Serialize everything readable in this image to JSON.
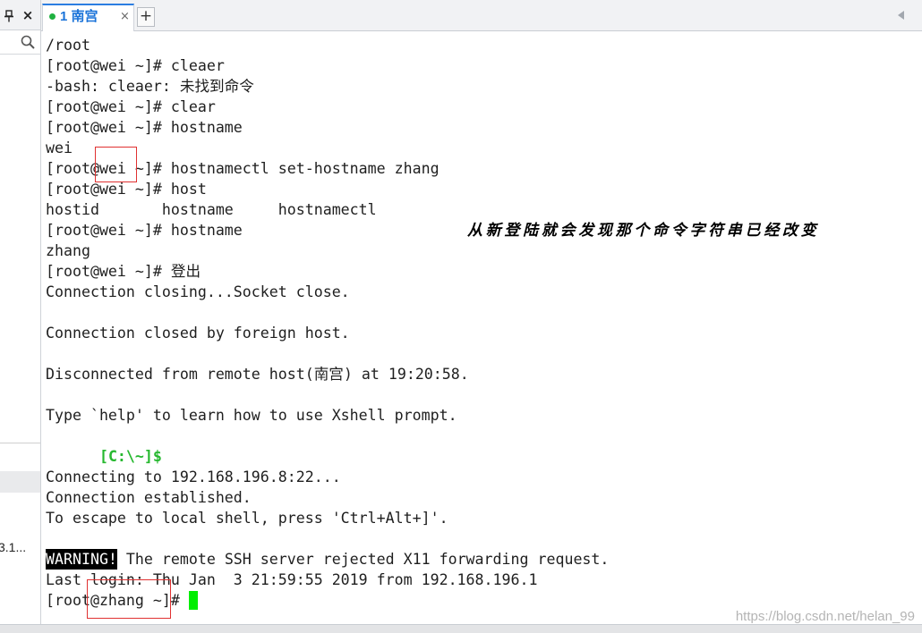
{
  "sidebar": {
    "close_label": "×",
    "partial_item": "3.1..."
  },
  "tabbar": {
    "tabs": [
      {
        "label": "1 南宫",
        "close_label": "×"
      }
    ],
    "new_tab_label": "+"
  },
  "icons": {
    "pin": "pin-icon",
    "search": "search-icon",
    "tab_status": "green-dot-icon",
    "scroll_tabs_left": "triangle-left-icon"
  },
  "terminal": {
    "lines": [
      "/root",
      "[root@wei ~]# cleaer",
      "-bash: cleaer: 未找到命令",
      "[root@wei ~]# clear",
      "[root@wei ~]# hostname",
      "wei",
      "[root@wei ~]# hostnamectl set-hostname zhang",
      "[root@wei ~]# host",
      "hostid       hostname     hostnamectl",
      "[root@wei ~]# hostname",
      "zhang",
      "[root@wei ~]# 登出",
      "Connection closing...Socket close.",
      "",
      "Connection closed by foreign host.",
      "",
      "Disconnected from remote host(南宫) at 19:20:58.",
      "",
      "Type `help' to learn how to use Xshell prompt.",
      {
        "text": "[C:\\~]$"
      },
      "",
      "Connecting to 192.168.196.8:22...",
      "Connection established.",
      "To escape to local shell, press 'Ctrl+Alt+]'.",
      "",
      {
        "badge": "WARNING!",
        "text": " The remote SSH server rejected X11 forwarding request."
      },
      "Last login: Thu Jan  3 21:59:55 2019 from 192.168.196.1",
      {
        "prompt": "[root@zhang ~]# "
      }
    ]
  },
  "annotation": {
    "text": "从新登陆就会发现那个命令字符串已经改变"
  },
  "watermark": "https://blog.csdn.net/helan_99",
  "colors": {
    "tab_text": "#1a73d9",
    "tab_active_border": "#2b7de1",
    "tab_status_dot": "#1fb141",
    "local_prompt": "#26b82f",
    "cursor": "#00ee00",
    "warning_bg": "#000000",
    "warning_text": "#ffffff",
    "highlight_box": "#e03131",
    "terminal_text": "#1f1f1f"
  }
}
